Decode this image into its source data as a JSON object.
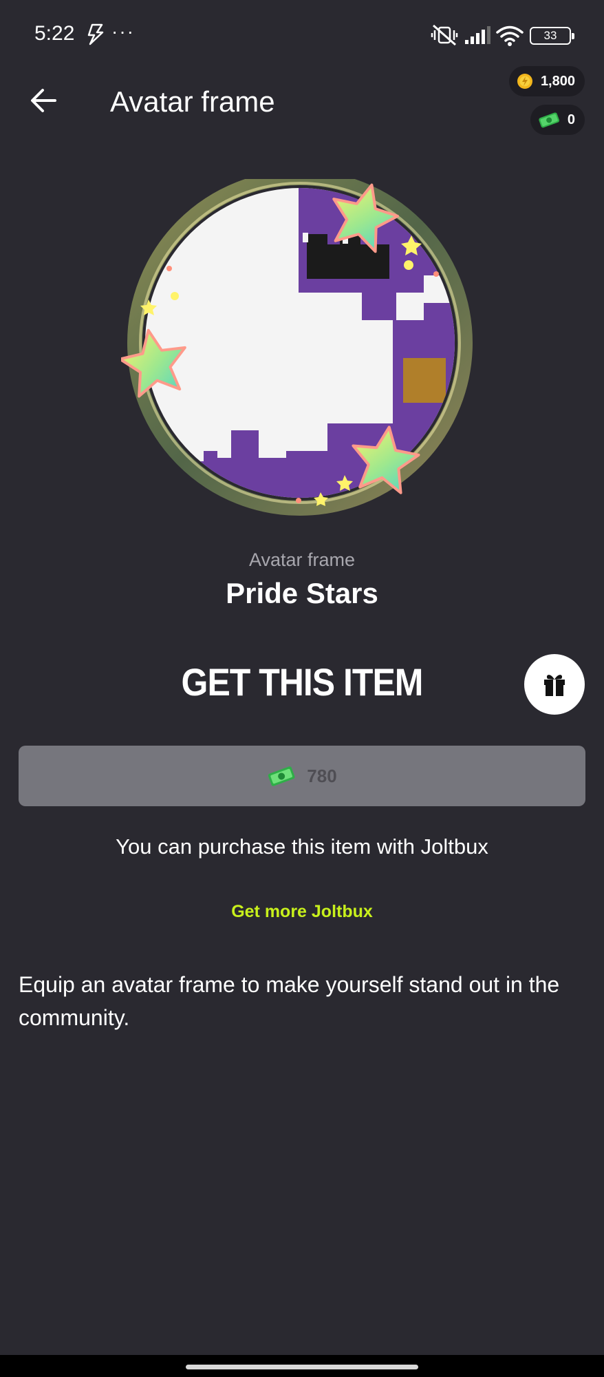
{
  "status_bar": {
    "time": "5:22",
    "more": "···",
    "battery": "33"
  },
  "header": {
    "title": "Avatar frame",
    "coins": "1,800",
    "joltbux": "0"
  },
  "item": {
    "type_label": "Avatar frame",
    "name": "Pride Stars"
  },
  "purchase": {
    "heading": "GET THIS ITEM",
    "price": "780",
    "note": "You can purchase this item with Joltbux",
    "get_more_link": "Get more Joltbux",
    "description": "Equip an avatar frame to make yourself stand out in the community."
  },
  "colors": {
    "background": "#2a2930",
    "accent_link": "#c8f01c",
    "button_disabled": "#76767d",
    "avatar_purple": "#6b3fa0"
  },
  "icons": {
    "back": "arrow-left-icon",
    "gift": "gift-icon",
    "coin": "coin-icon",
    "joltbux": "joltbux-icon"
  }
}
